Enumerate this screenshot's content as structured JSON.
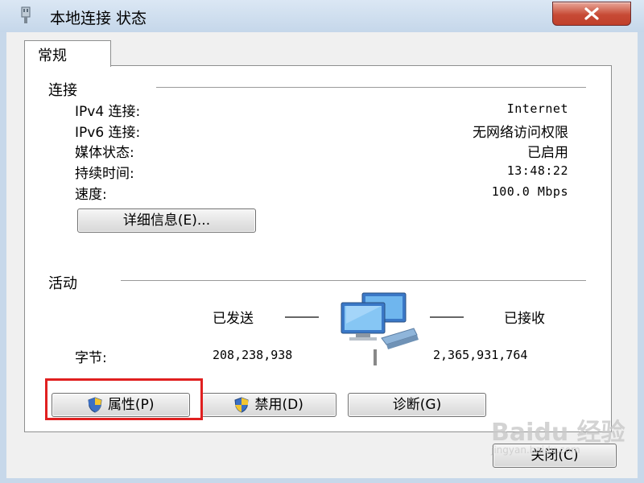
{
  "window": {
    "title": "本地连接 状态"
  },
  "tabs": [
    {
      "label": "常规"
    }
  ],
  "connection": {
    "heading": "连接",
    "rows": [
      {
        "label": "IPv4 连接:",
        "value": "Internet"
      },
      {
        "label": "IPv6 连接:",
        "value": "无网络访问权限"
      },
      {
        "label": "媒体状态:",
        "value": "已启用"
      },
      {
        "label": "持续时间:",
        "value": "13:48:22"
      },
      {
        "label": "速度:",
        "value": "100.0 Mbps"
      }
    ],
    "details_button": "详细信息(E)..."
  },
  "activity": {
    "heading": "活动",
    "sent_label": "已发送",
    "received_label": "已接收",
    "bytes_label": "字节:",
    "bytes_sent": "208,238,938",
    "bytes_received": "2,365,931,764"
  },
  "buttons": {
    "properties": "属性(P)",
    "disable": "禁用(D)",
    "diagnose": "诊断(G)",
    "close": "关闭(C)"
  },
  "watermark": {
    "line1": "Baidu 经验",
    "line2": "jingyan.baidu.com"
  },
  "icons": [
    "network-adapter-icon",
    "close-icon",
    "shield-icon",
    "network-computers-icon"
  ],
  "colors": {
    "highlight": "#e02020",
    "titlebar": "#c5d7ea",
    "close_button": "#c74a35"
  }
}
